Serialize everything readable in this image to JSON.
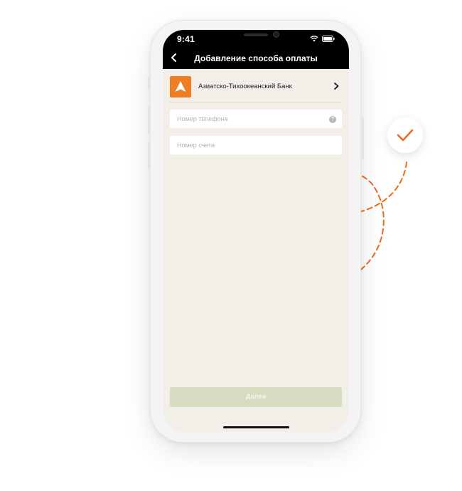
{
  "status_bar": {
    "time": "9:41"
  },
  "header": {
    "title": "Добавление способа оплаты"
  },
  "bank": {
    "name": "Азиатско-Тихоокеанский Банк"
  },
  "form": {
    "phone_placeholder": "Номер телефона",
    "account_placeholder": "Номер счета",
    "help_glyph": "?"
  },
  "actions": {
    "next_label": "Далее"
  },
  "colors": {
    "accent": "#ef7d24",
    "button_disabled": "#d5dcc0",
    "screen_bg": "#f2eee8"
  },
  "icons": [
    "back-arrow-icon",
    "chevron-right-icon",
    "help-icon",
    "check-icon",
    "wifi-icon",
    "battery-icon",
    "signal-icon",
    "bank-logo-icon"
  ]
}
